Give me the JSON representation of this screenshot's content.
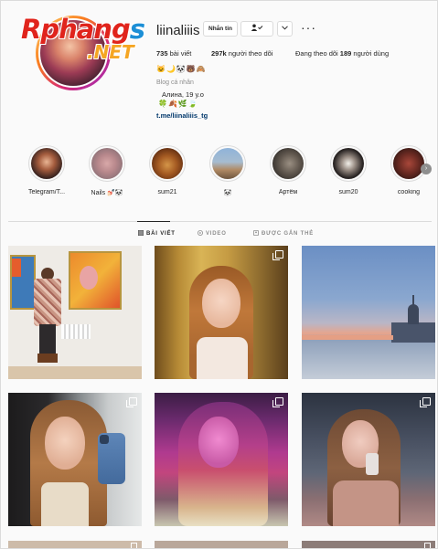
{
  "watermark": {
    "main": "Rphang",
    "accent": "s",
    "sub": ".NET"
  },
  "profile": {
    "username": "liinaliiis",
    "message_button": "Nhắn tin",
    "follow_icon": "person-check-icon",
    "more_icon": "chevron-down-icon",
    "options_icon": "more-horizontal-icon",
    "posts": {
      "count": "735",
      "label": "bài viết"
    },
    "followers": {
      "count": "297k",
      "label": "người theo dõi"
    },
    "following": {
      "prefix": "Đang theo dõi",
      "count": "189",
      "label": "người dùng"
    },
    "emoji_line1": "🐱🌙🐼🐻🙈",
    "category": "Blog cá nhân",
    "bio_line": "Алина, 19 y.o",
    "emoji_line2": "🍀🍂🌿🍃",
    "link": "t.me/liinaliiis_tg"
  },
  "highlights": [
    {
      "label": "Telegram/T..."
    },
    {
      "label": "Nails 💅🏻🐼"
    },
    {
      "label": "sum21"
    },
    {
      "label": "🐼"
    },
    {
      "label": "Артём"
    },
    {
      "label": "sum20"
    },
    {
      "label": "cooking"
    }
  ],
  "tabs": [
    {
      "label": "BÀI VIẾT",
      "icon": "grid-icon",
      "active": true
    },
    {
      "label": "VIDEO",
      "icon": "video-icon",
      "active": false
    },
    {
      "label": "ĐƯỢC GẮN THẺ",
      "icon": "tag-icon",
      "active": false
    }
  ],
  "colors": {
    "accent": "#0095f6",
    "ring": "#d62976",
    "text": "#262626",
    "muted": "#8e8e8e",
    "link": "#00376b"
  }
}
